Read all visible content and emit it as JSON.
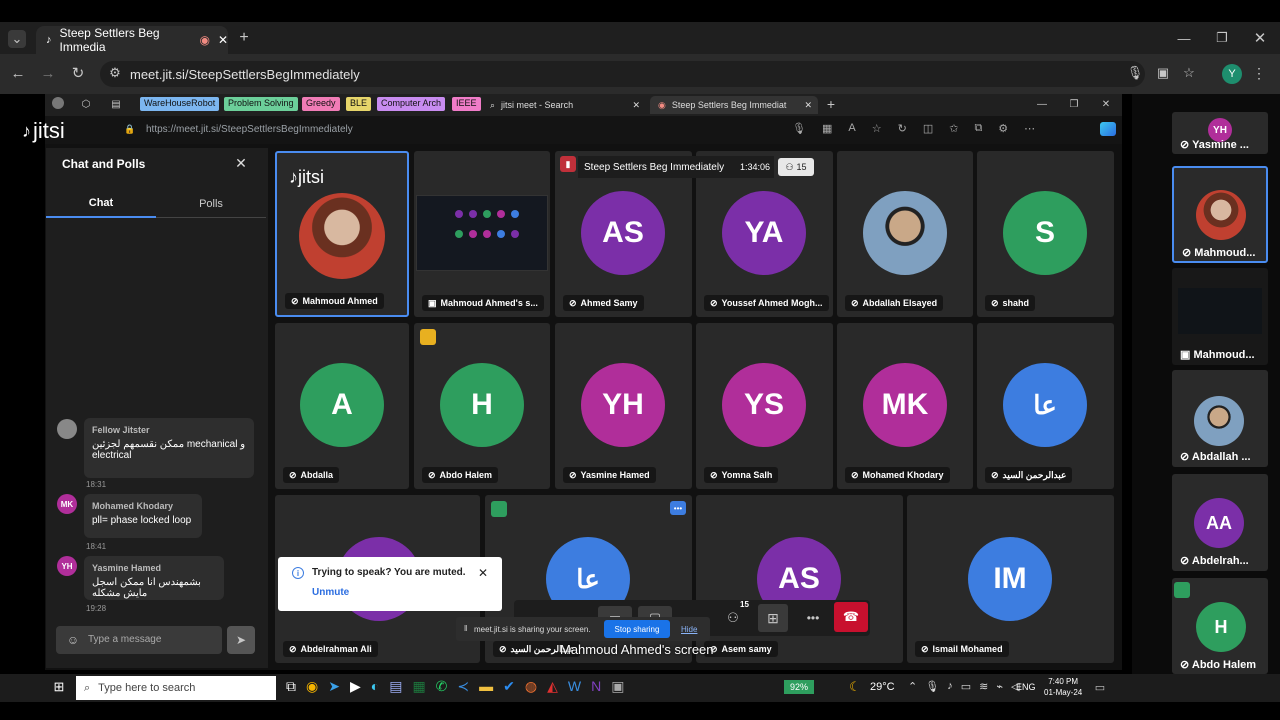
{
  "browser": {
    "tab_title": "Steep Settlers Beg Immedia",
    "url": "meet.jit.si/SteepSettlersBegImmediately",
    "profile": "Y"
  },
  "edge": {
    "url": "https://meet.jit.si/SteepSettlersBegImmediately",
    "bookmarks": [
      "WareHouseRobot",
      "Problem Solving",
      "Greedy",
      "BLE",
      "Computer Arch",
      "IEEE"
    ],
    "tab1": "jitsi meet - Search",
    "tab2": "Steep Settlers Beg Immediat"
  },
  "jitsi": {
    "logo": "jitsi",
    "meeting_name": "Steep Settlers Beg Immediately",
    "timer": "1:34:06",
    "participants": "15"
  },
  "chat": {
    "title": "Chat and Polls",
    "tab_chat": "Chat",
    "tab_polls": "Polls",
    "placeholder": "Type a message",
    "messages": [
      {
        "sender": "Fellow Jitster",
        "text": "ممكن نقسمهم لجزئين mechanical و electrical",
        "time": "18:31",
        "initials": ""
      },
      {
        "sender": "Mohamed Khodary",
        "text": "pll= phase locked loop",
        "time": "18:41",
        "initials": "MK"
      },
      {
        "sender": "Yasmine Hamed",
        "text": "بشمهندس انا ممكن اسجل مايش مشكله",
        "time": "19:28",
        "initials": "YH"
      }
    ]
  },
  "tiles": [
    {
      "name": "Mahmoud Ahmed",
      "initials": "",
      "color": ""
    },
    {
      "name": "Mahmoud Ahmed's s...",
      "initials": "",
      "color": ""
    },
    {
      "name": "Ahmed Samy",
      "initials": "AS",
      "color": "#7b2fa8"
    },
    {
      "name": "Youssef Ahmed Mogh...",
      "initials": "YA",
      "color": "#7b2fa8"
    },
    {
      "name": "Abdallah Elsayed",
      "initials": "",
      "color": ""
    },
    {
      "name": "shahd",
      "initials": "S",
      "color": "#2e9e5e"
    },
    {
      "name": "Abdalla",
      "initials": "A",
      "color": "#2e9e5e"
    },
    {
      "name": "Abdo Halem",
      "initials": "H",
      "color": "#2e9e5e"
    },
    {
      "name": "Yasmine Hamed",
      "initials": "YH",
      "color": "#b02e9a"
    },
    {
      "name": "Yomna Salh",
      "initials": "YS",
      "color": "#b02e9a"
    },
    {
      "name": "Mohamed Khodary",
      "initials": "MK",
      "color": "#b02e9a"
    },
    {
      "name": "عبدالرحمن السيد",
      "initials": "عا",
      "color": "#3d7de0"
    },
    {
      "name": "Abdelrahman Ali",
      "initials": "",
      "color": "#7b2fa8"
    },
    {
      "name": "عبدالرحمن السيد",
      "initials": "عا",
      "color": "#3d7de0"
    },
    {
      "name": "Asem samy",
      "initials": "AS",
      "color": "#7b2fa8"
    },
    {
      "name": "Ismail Mohamed",
      "initials": "IM",
      "color": "#3d7de0"
    }
  ],
  "notice": {
    "title": "Trying to speak? You are muted.",
    "action": "Unmute"
  },
  "share": {
    "text": "meet.jit.si is sharing your screen.",
    "stop": "Stop sharing",
    "hide": "Hide"
  },
  "caption": "Mahmoud Ahmed's screen",
  "toolbar": {
    "participants_badge": "15"
  },
  "right": [
    {
      "name": "Yasmine ...",
      "initials": "YH",
      "color": "#b02e9a"
    },
    {
      "name": "Mahmoud...",
      "initials": "",
      "color": ""
    },
    {
      "name": "Mahmoud...",
      "initials": "",
      "color": ""
    },
    {
      "name": "Abdallah ...",
      "initials": "",
      "color": ""
    },
    {
      "name": "Abdelrah...",
      "initials": "AA",
      "color": "#7b2fa8"
    },
    {
      "name": "Abdo Halem",
      "initials": "H",
      "color": "#2e9e5e"
    }
  ],
  "taskbar": {
    "search": "Type here to search",
    "battery": "92%",
    "temp": "29°C",
    "lang": "ENG",
    "time": "7:40 PM",
    "date": "01-May-24"
  }
}
